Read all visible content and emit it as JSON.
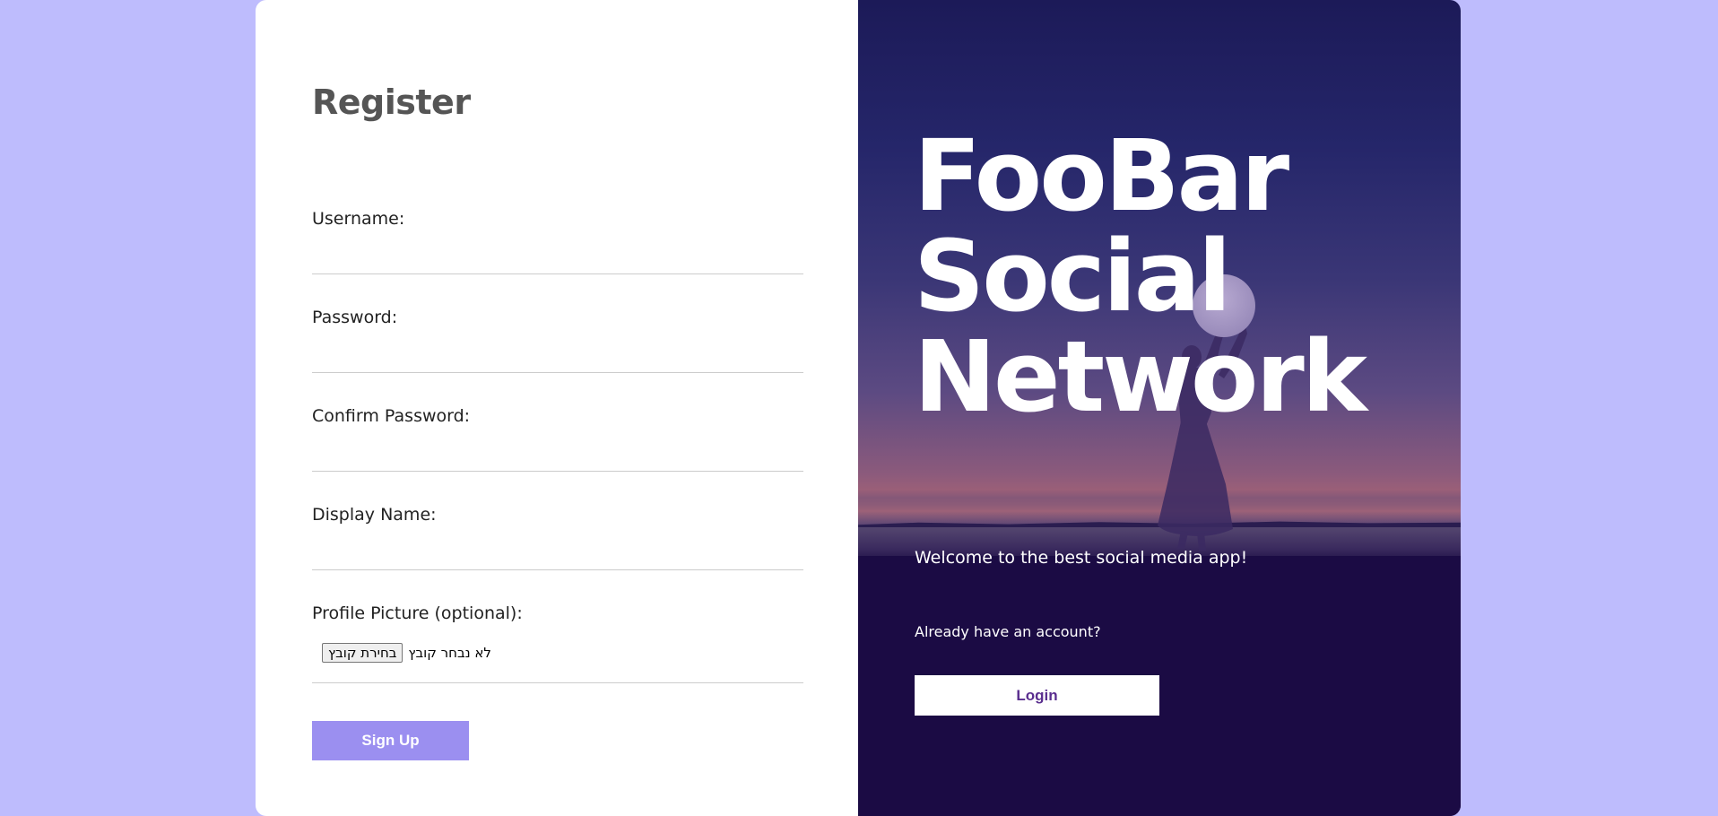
{
  "register": {
    "title": "Register",
    "fields": [
      {
        "label": "Username:",
        "value": ""
      },
      {
        "label": "Password:",
        "value": ""
      },
      {
        "label": "Confirm Password:",
        "value": ""
      },
      {
        "label": "Display Name:",
        "value": ""
      },
      {
        "label": "Profile Picture (optional):"
      }
    ],
    "file_button_label": "בחירת קובץ",
    "file_status": "לא נבחר קובץ",
    "signup_label": "Sign Up"
  },
  "hero": {
    "brand_line1": "FooBar",
    "brand_line2": "Social",
    "brand_line3": "Network",
    "welcome": "Welcome to the best social media app!",
    "already": "Already have an account?",
    "login_label": "Login"
  },
  "colors": {
    "page_background": "#bebcfd",
    "signup_button": "#9b8ff0",
    "hero_dark": "#1b0c44",
    "login_text": "#5a2e8f"
  }
}
